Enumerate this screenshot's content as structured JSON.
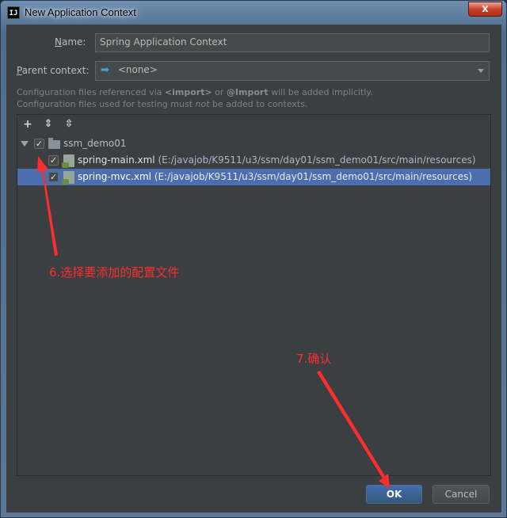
{
  "window": {
    "title": "New Application Context",
    "app_icon_text": "IJ",
    "close_glyph": "x"
  },
  "form": {
    "name_label_u": "N",
    "name_label_rest": "ame:",
    "name_value": "Spring Application Context",
    "parent_label_u": "P",
    "parent_label_rest": "arent context:",
    "parent_value": "<none>",
    "hint_line1_a": "Configuration files referenced via ",
    "hint_line1_b": "<import>",
    "hint_line1_c": " or ",
    "hint_line1_d": "@Import",
    "hint_line1_e": " will be added implicitly.",
    "hint_line2_a": "Configuration files used for testing must ",
    "hint_line2_b": "not",
    "hint_line2_c": " be added to contexts."
  },
  "toolbar": {
    "add_glyph": "+",
    "expand_glyph": "⇕",
    "collapse_glyph": "⇳"
  },
  "tree": {
    "root": {
      "label": "ssm_demo01",
      "checked": true
    },
    "files": [
      {
        "name": "spring-main.xml",
        "path": "(E:/javajob/K9511/u3/ssm/day01/ssm_demo01/src/main/resources)",
        "checked": true,
        "selected": false
      },
      {
        "name": "spring-mvc.xml",
        "path": "(E:/javajob/K9511/u3/ssm/day01/ssm_demo01/src/main/resources)",
        "checked": true,
        "selected": true
      }
    ]
  },
  "annotations": {
    "step6": "6.选择要添加的配置文件",
    "step7": "7.确认"
  },
  "buttons": {
    "ok": "OK",
    "cancel": "Cancel"
  },
  "colors": {
    "dialog_bg": "#3c3f41",
    "selection": "#4b6eaf",
    "annotation": "#ff2d2d"
  },
  "icons": [
    "app-icon",
    "close-icon",
    "arrow-right-icon",
    "chevron-down-icon",
    "add-icon",
    "expand-all-icon",
    "collapse-all-icon",
    "folder-icon",
    "xml-file-icon"
  ]
}
